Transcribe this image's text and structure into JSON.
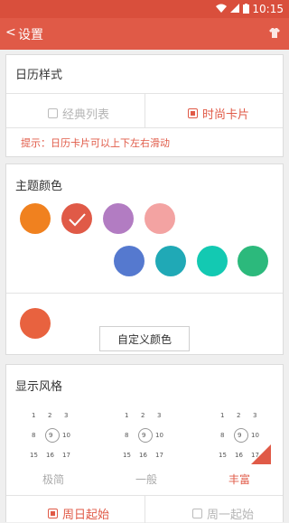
{
  "statusbar": {
    "time": "10:15"
  },
  "titlebar": {
    "back_glyph": "<",
    "title": "设置"
  },
  "calendar_style": {
    "heading": "日历样式",
    "options": [
      "经典列表",
      "时尚卡片"
    ],
    "selected": "时尚卡片",
    "hint": "提示：日历卡片可以上下左右滑动"
  },
  "theme_color": {
    "heading": "主题颜色",
    "swatches": [
      "#f0811f",
      "#e05a47",
      "#b27cc2",
      "#f3a3a2",
      "#5579cf",
      "#20a9b6",
      "#13c9b2",
      "#2cb97c"
    ],
    "selected": "#e05a47",
    "custom_preview": "#e8623f",
    "custom_button": "自定义颜色"
  },
  "display_style": {
    "heading": "显示风格",
    "mini_numbers": [
      [
        "1",
        "2",
        "3"
      ],
      [
        "8",
        "9",
        "10"
      ],
      [
        "15",
        "16",
        "17"
      ]
    ],
    "options": [
      "极简",
      "一般",
      "丰富"
    ],
    "selected": "丰富"
  },
  "week_start": {
    "options": [
      "周日起始",
      "周一起始"
    ],
    "selected": "周日起始"
  },
  "colors": {
    "accent": "#e05a47",
    "header": "#e05a47",
    "statusbar": "#d94f3c"
  }
}
